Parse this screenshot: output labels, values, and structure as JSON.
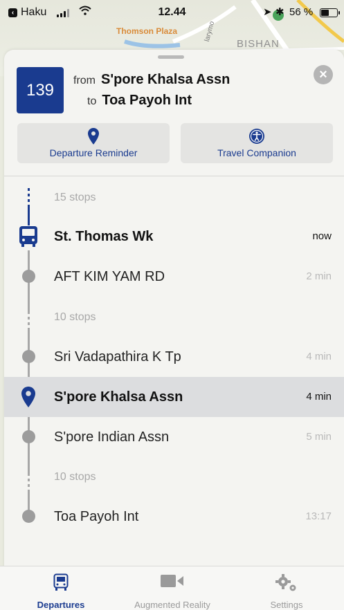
{
  "status_bar": {
    "carrier": "Haku",
    "time": "12.44",
    "battery_percent": "56 %",
    "battery_level": 0.56
  },
  "map": {
    "label_plaza": "Thomson Plaza",
    "label_area": "BISHAN",
    "label_road": "larymo"
  },
  "route": {
    "number": "139",
    "from_word": "from",
    "from_stop": "S'pore Khalsa Assn",
    "to_word": "to",
    "to_stop": "Toa Payoh Int"
  },
  "actions": {
    "departure_reminder": "Departure Reminder",
    "travel_companion": "Travel Companion"
  },
  "stops": {
    "prev_count": "15 stops",
    "current": {
      "name": "St. Thomas Wk",
      "eta": "now"
    },
    "stop1": {
      "name": "AFT KIM YAM RD",
      "eta": "2 min"
    },
    "mid_count_1": "10 stops",
    "stop2": {
      "name": "Sri Vadapathira K Tp",
      "eta": "4 min"
    },
    "selected": {
      "name": "S'pore Khalsa Assn",
      "eta": "4 min"
    },
    "stop3": {
      "name": "S'pore Indian Assn",
      "eta": "5 min"
    },
    "mid_count_2": "10 stops",
    "stop4": {
      "name": "Toa Payoh Int",
      "eta": "13:17"
    }
  },
  "tabs": {
    "departures": "Departures",
    "augmented_reality": "Augmented Reality",
    "settings": "Settings"
  },
  "colors": {
    "accent": "#1a3b8f",
    "timeline": "#a7a7a7",
    "highlight_row": "#dcdddf"
  }
}
